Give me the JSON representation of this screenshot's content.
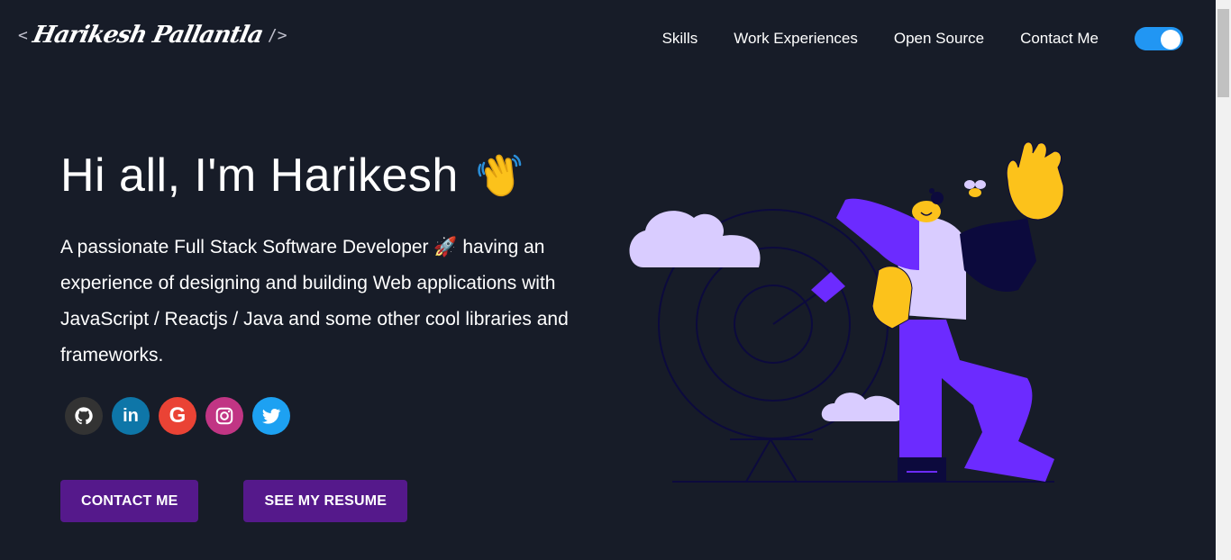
{
  "header": {
    "logo_open": "<",
    "logo_name": "Harikesh Pallantla",
    "logo_close": "/>",
    "nav": [
      {
        "label": "Skills"
      },
      {
        "label": "Work Experiences"
      },
      {
        "label": "Open Source"
      },
      {
        "label": "Contact Me"
      }
    ],
    "theme_toggle": {
      "state": "on",
      "color": "#2196f3"
    }
  },
  "hero": {
    "title": "Hi all, I'm Harikesh",
    "title_emoji_icon": "waving-hand-icon",
    "subtitle_part1": "A passionate Full Stack Software Developer ",
    "subtitle_emoji": "🚀",
    "subtitle_part2": " having an experience of designing and building Web applications with JavaScript / Reactjs / Java and some other cool libraries and frameworks.",
    "socials": [
      {
        "name": "github-icon",
        "glyph": "⌬",
        "color": "#333333"
      },
      {
        "name": "linkedin-icon",
        "glyph": "in",
        "color": "#0e76a8"
      },
      {
        "name": "google-icon",
        "glyph": "G",
        "color": "#ea4335"
      },
      {
        "name": "instagram-icon",
        "glyph": "◎",
        "color": "#c13584"
      },
      {
        "name": "twitter-icon",
        "glyph": "🐦",
        "color": "#1da1f2"
      }
    ],
    "buttons": {
      "contact": "CONTACT ME",
      "resume": "SEE MY RESUME"
    },
    "button_color": "#55198b"
  },
  "theme": {
    "background": "#171c28",
    "accent": "#6c2bff"
  }
}
